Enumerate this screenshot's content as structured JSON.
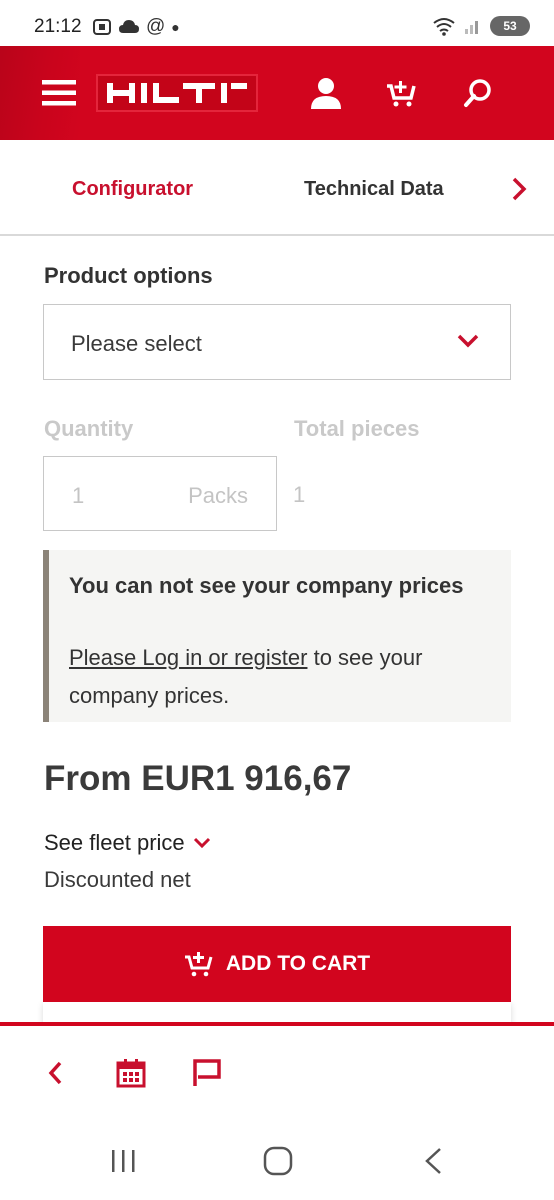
{
  "status_bar": {
    "time": "21:12",
    "battery": "53"
  },
  "header": {
    "brand": "HILTI"
  },
  "tabs": {
    "configurator": "Configurator",
    "technical_data": "Technical Data"
  },
  "product_options": {
    "title": "Product options",
    "placeholder": "Please select"
  },
  "quantity": {
    "label": "Quantity",
    "value": "1",
    "unit": "Packs"
  },
  "total_pieces": {
    "label": "Total pieces",
    "value": "1"
  },
  "notice": {
    "title": "You can not see your company prices",
    "link": "Please Log in or register",
    "body_suffix": " to see your company prices."
  },
  "price": {
    "text": "From EUR1 916,67"
  },
  "fleet": {
    "label": "See fleet price",
    "sub": "Discounted net"
  },
  "cart_button": {
    "label": "ADD TO CART"
  },
  "colors": {
    "brand_red": "#d2051e",
    "muted": "#c9c9c9"
  },
  "icons": [
    "menu-icon",
    "user-icon",
    "cart-icon",
    "search-icon",
    "chevron-right-icon",
    "chevron-down-icon",
    "back-icon",
    "calendar-icon",
    "flag-icon"
  ]
}
